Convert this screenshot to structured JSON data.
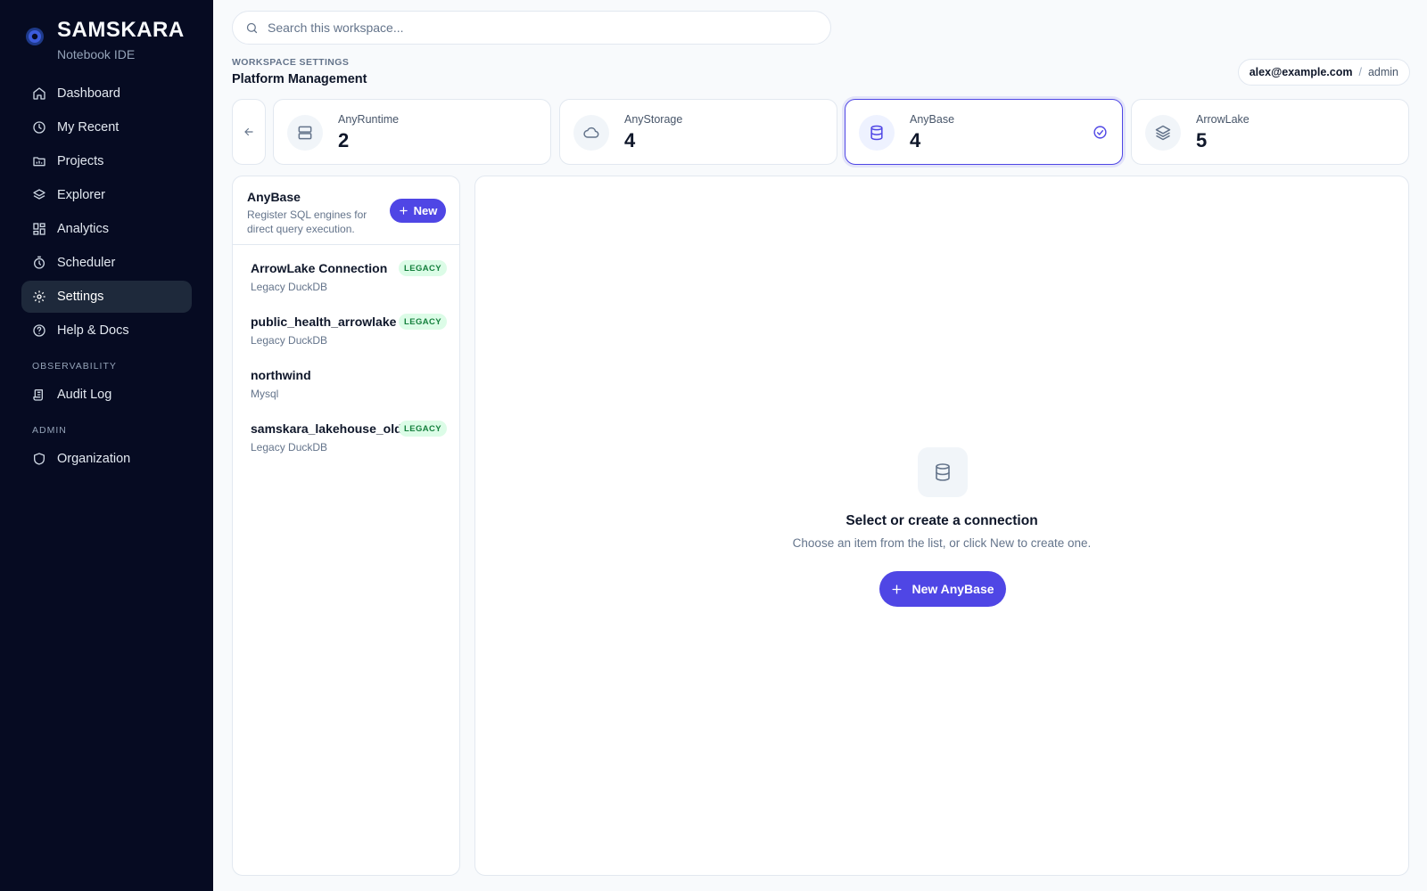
{
  "brand": {
    "name": "SAMSKARA",
    "subtitle": "Notebook IDE",
    "accent": "#4f46e5"
  },
  "sidebar": {
    "items": [
      {
        "label": "Dashboard",
        "icon": "home-icon"
      },
      {
        "label": "My Recent",
        "icon": "clock-icon"
      },
      {
        "label": "Projects",
        "icon": "folder-icon"
      },
      {
        "label": "Explorer",
        "icon": "layers-icon"
      },
      {
        "label": "Analytics",
        "icon": "grid-icon"
      },
      {
        "label": "Scheduler",
        "icon": "timer-icon"
      },
      {
        "label": "Settings",
        "icon": "gear-icon",
        "active": true
      },
      {
        "label": "Help & Docs",
        "icon": "help-icon"
      }
    ],
    "sections": [
      {
        "title": "OBSERVABILITY",
        "items": [
          {
            "label": "Audit Log",
            "icon": "scroll-icon"
          }
        ]
      },
      {
        "title": "ADMIN",
        "items": [
          {
            "label": "Organization",
            "icon": "shield-icon"
          }
        ]
      }
    ]
  },
  "search": {
    "placeholder": "Search this workspace..."
  },
  "breadcrumb": {
    "section": "WORKSPACE SETTINGS",
    "title": "Platform Management"
  },
  "user": {
    "email": "alex@example.com",
    "separator": "/",
    "role": "admin"
  },
  "stats": [
    {
      "label": "AnyRuntime",
      "value": "2",
      "icon": "server-icon"
    },
    {
      "label": "AnyStorage",
      "value": "4",
      "icon": "cloud-icon"
    },
    {
      "label": "AnyBase",
      "value": "4",
      "icon": "database-icon",
      "active": true
    },
    {
      "label": "ArrowLake",
      "value": "5",
      "icon": "layers-icon"
    }
  ],
  "list": {
    "title": "AnyBase",
    "description": "Register SQL engines for direct query execution.",
    "new_label": "New",
    "items": [
      {
        "name": "ArrowLake Connection",
        "type": "Legacy DuckDB",
        "badge": "LEGACY"
      },
      {
        "name": "public_health_arrowlake",
        "type": "Legacy DuckDB",
        "badge": "LEGACY"
      },
      {
        "name": "northwind",
        "type": "Mysql",
        "badge": ""
      },
      {
        "name": "samskara_lakehouse_old",
        "type": "Legacy DuckDB",
        "badge": "LEGACY"
      }
    ]
  },
  "empty": {
    "title": "Select or create a connection",
    "subtitle": "Choose an item from the list, or click New to create one.",
    "button_label": "New AnyBase"
  }
}
